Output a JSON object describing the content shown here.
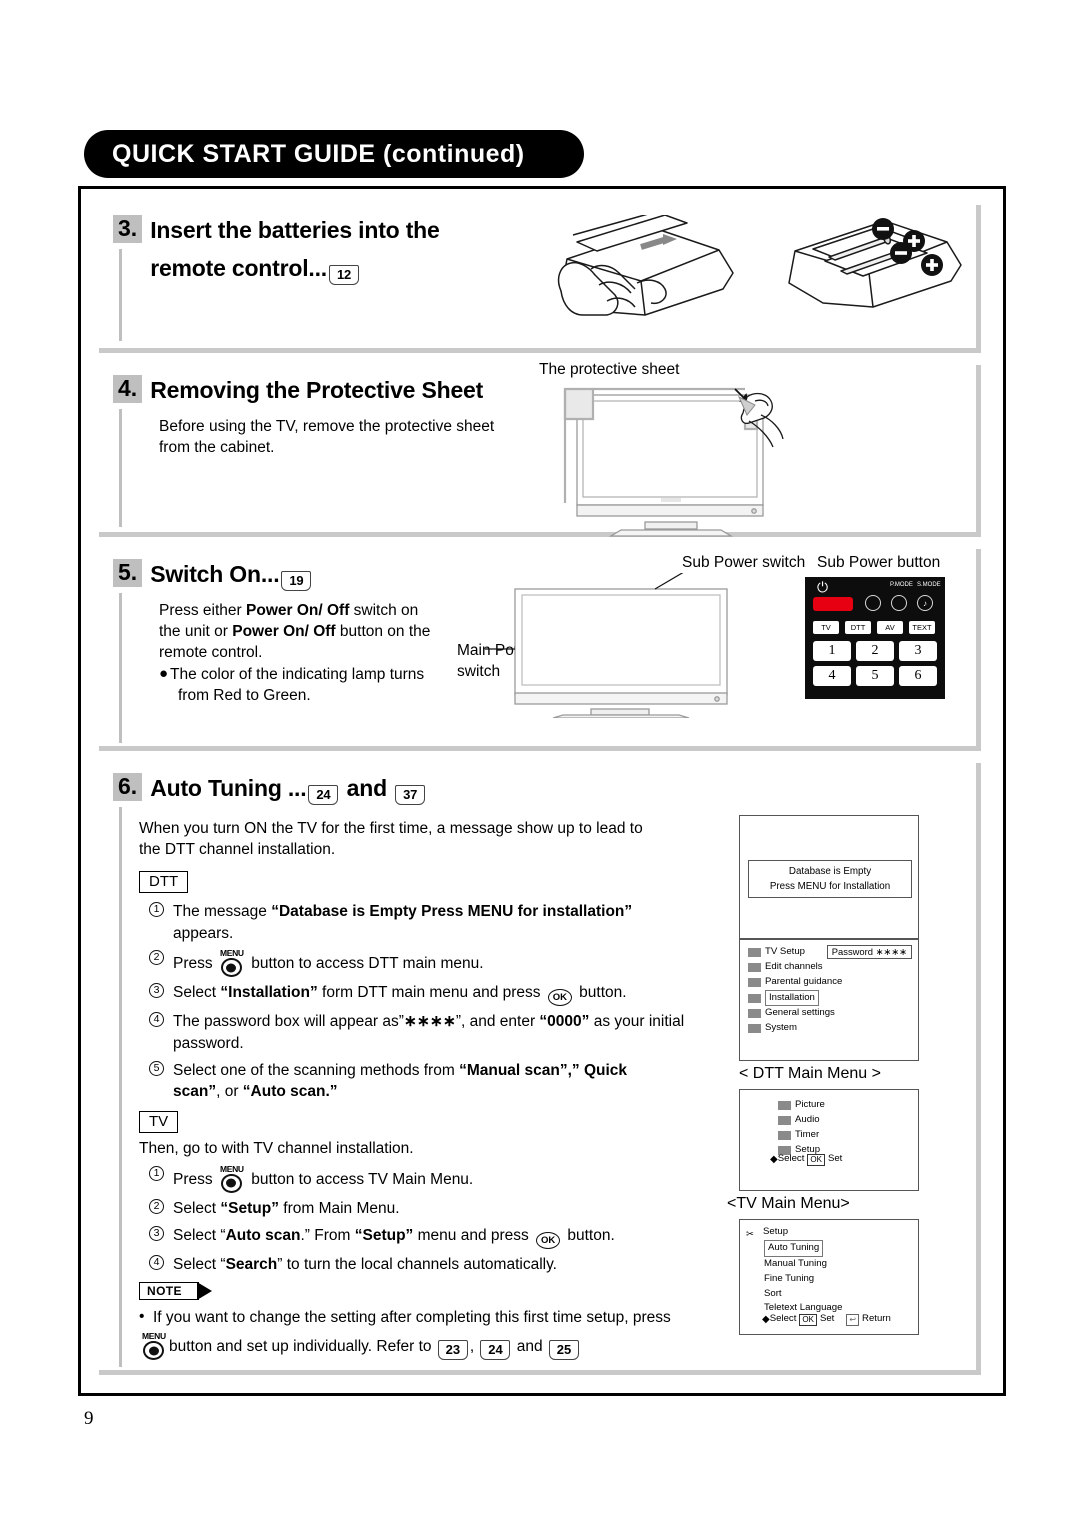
{
  "header": {
    "title": "QUICK START GUIDE (continued)"
  },
  "page_number": "9",
  "sections": [
    {
      "number": "3.",
      "title_line1": "Insert the batteries into the",
      "title_line2": "remote control...",
      "page_ref": "12"
    },
    {
      "number": "4.",
      "title": "Removing the Protective Sheet",
      "body_line1": "Before using the TV, remove the protective sheet",
      "body_line2": "from the cabinet.",
      "illustration_label": "The protective sheet"
    },
    {
      "number": "5.",
      "title": "Switch On...",
      "page_ref": "19",
      "body_line1_a": "Press either ",
      "body_line1_b": "Power On/ Off",
      "body_line1_c": " switch on",
      "body_line2_a": "the unit or ",
      "body_line2_b": "Power On/ Off",
      "body_line2_c": " button on the",
      "body_line3": "remote control.",
      "bullet_line1": "The color of the indicating lamp turns",
      "bullet_line2": "from Red to Green.",
      "label_main_power_l1": "Main Power",
      "label_main_power_l2": "switch",
      "label_sub_power_switch": "Sub Power switch",
      "label_sub_power_button": "Sub Power button"
    },
    {
      "number": "6.",
      "title": "Auto Tuning ...",
      "page_ref_1": "24",
      "and_word": "and",
      "page_ref_2": "37",
      "intro_line1": "When you turn ON the TV for the first time, a message show up to lead to",
      "intro_line2": "the DTT channel installation.",
      "tag_dtt": "DTT",
      "tag_tv": "TV",
      "tv_intro": "Then, go to with TV channel installation."
    }
  ],
  "dtt_steps": [
    {
      "num": "①",
      "pre": "The message ",
      "bold": "“Database is Empty Press MENU for installation”",
      "post": "",
      "line2": "appears."
    },
    {
      "num": "②",
      "pre": "Press ",
      "icon": "menu-button",
      "post": " button to access DTT main menu."
    },
    {
      "num": "③",
      "pre": "Select ",
      "bold": "“Installation”",
      "mid": " form DTT main menu and press ",
      "icon": "ok-button",
      "post": " button."
    },
    {
      "num": "④",
      "pre": "The password box will appear as”",
      "bold": "∗∗∗∗",
      "mid": "”, and enter ",
      "bold2": "“0000”",
      "post": " as your initial",
      "line2": "password."
    },
    {
      "num": "⑤",
      "pre": "Select one of the scanning methods from ",
      "bold": "“Manual scan”,” Quick",
      "line2_bold": "scan”",
      "line2_mid": ", or ",
      "line2_bold2": "“Auto scan.”"
    }
  ],
  "tv_steps": [
    {
      "num": "①",
      "pre": "Press ",
      "icon": "menu-button",
      "post": " button to access TV Main Menu."
    },
    {
      "num": "②",
      "pre": "Select ",
      "bold": "“Setup”",
      "post": " from Main Menu."
    },
    {
      "num": "③",
      "pre": "Select “",
      "bold": "Auto scan",
      "mid": ".” From ",
      "bold2": "“Setup”",
      "mid2": " menu and press ",
      "icon": "ok-button",
      "post": " button."
    },
    {
      "num": "④",
      "pre": "Select “",
      "bold": "Search",
      "post": "” to turn the local channels automatically."
    }
  ],
  "note": {
    "label": "NOTE",
    "line1": "If you want to change the setting after completing this first time setup, press",
    "line2_a": "button and set up individually. Refer to",
    "ref1": "23",
    "sep": ",",
    "ref2": "24",
    "and_word": "and",
    "ref3": "25"
  },
  "osd": {
    "message_screen": {
      "line1": "Database is Empty",
      "line2": "Press MENU for Installation"
    },
    "dtt_menu": {
      "caption": "< DTT Main Menu >",
      "password_label": "Password",
      "password_value": "∗∗∗∗",
      "items": [
        {
          "label": "TV Setup",
          "selected": false
        },
        {
          "label": "Edit channels",
          "selected": false
        },
        {
          "label": "Parental guidance",
          "selected": false
        },
        {
          "label": "Installation",
          "selected": true
        },
        {
          "label": "General settings",
          "selected": false
        },
        {
          "label": "System",
          "selected": false
        }
      ]
    },
    "tv_menu": {
      "caption": "<TV Main Menu>",
      "items": [
        {
          "label": "Picture"
        },
        {
          "label": "Audio"
        },
        {
          "label": "Timer"
        },
        {
          "label": "Setup"
        }
      ],
      "footer_select": "Select",
      "footer_ok": "OK",
      "footer_set": "Set"
    },
    "setup_menu": {
      "header": "Setup",
      "items": [
        {
          "label": "Auto Tuning",
          "selected": true
        },
        {
          "label": "Manual Tuning",
          "selected": false
        },
        {
          "label": "Fine Tuning",
          "selected": false
        },
        {
          "label": "Sort",
          "selected": false
        },
        {
          "label": "Teletext Language",
          "selected": false
        }
      ],
      "footer_select": "Select",
      "footer_ok": "OK",
      "footer_set": "Set",
      "footer_return": "Return"
    }
  },
  "remote": {
    "power_symbol": "⏻",
    "pmode_label": "P.MODE",
    "smode_label": "S.MODE",
    "source_buttons": [
      "TV",
      "DTT",
      "AV",
      "TEXT"
    ],
    "number_buttons": [
      "1",
      "2",
      "3",
      "4",
      "5",
      "6"
    ],
    "power_color": "#e60012"
  }
}
